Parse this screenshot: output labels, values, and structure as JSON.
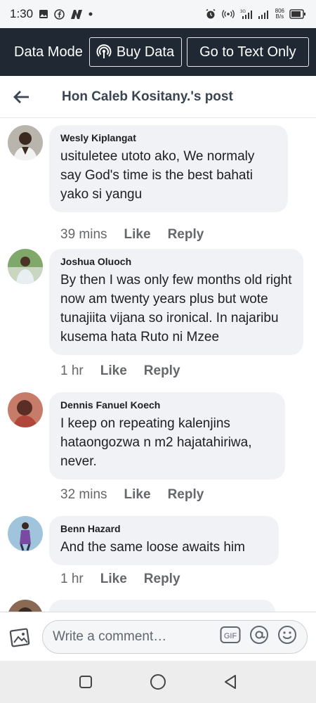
{
  "status_bar": {
    "time": "1:30",
    "network_type": "3G",
    "speed_value": "806",
    "speed_unit": "B/s"
  },
  "data_bar": {
    "mode_label": "Data Mode",
    "buy_data_label": "Buy Data",
    "text_only_label": "Go to Text Only"
  },
  "header": {
    "title": "Hon Caleb Kositany.'s post"
  },
  "comments": [
    {
      "author": "Wesly Kiplangat",
      "text": "usituletee utoto ako, We normaly say God's  time is the best bahati yako si yangu",
      "time": "39 mins",
      "like_label": "Like",
      "reply_label": "Reply"
    },
    {
      "author": "Joshua Oluoch",
      "text": "By then I was only few months old right now am twenty years plus but wote tunajiita vijana so ironical. In najaribu kusema hata Ruto ni Mzee",
      "time": "1 hr",
      "like_label": "Like",
      "reply_label": "Reply"
    },
    {
      "author": "Dennis Fanuel Koech",
      "text": "I keep on repeating kalenjins hataongozwa n m2 hajatahiriwa, never.",
      "time": "32 mins",
      "like_label": "Like",
      "reply_label": "Reply"
    },
    {
      "author": "Benn Hazard",
      "text": "And the same loose awaits him",
      "time": "1 hr",
      "like_label": "Like",
      "reply_label": "Reply"
    }
  ],
  "composer": {
    "placeholder": "Write a comment…",
    "gif_label": "GIF"
  },
  "colors": {
    "data_bar_bg": "#1f2833",
    "bubble_bg": "#f0f2f5",
    "meta_text": "#65676b",
    "header_title": "#3a4452"
  }
}
